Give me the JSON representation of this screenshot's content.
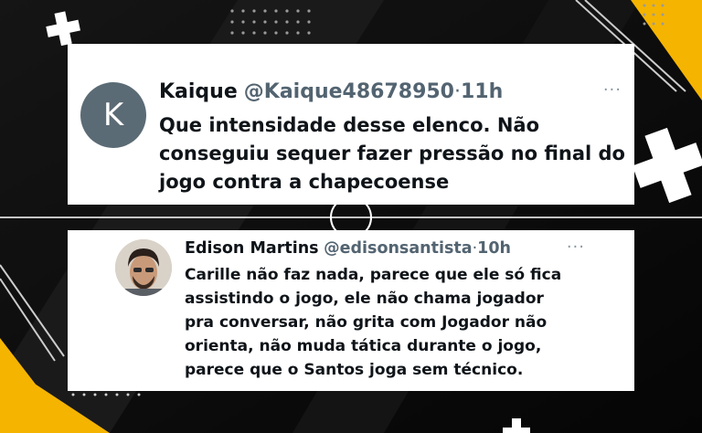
{
  "tweets": [
    {
      "avatar_letter": "K",
      "name": "Kaique",
      "handle": "@Kaique48678950",
      "separator": "·",
      "time": "11h",
      "more": "···",
      "lines": [
        "Que intensidade desse elenco. Não",
        "conseguiu sequer fazer pressão no final do",
        "jogo contra a chapecoense"
      ]
    },
    {
      "name": "Edison Martins",
      "handle": "@edisonsantista",
      "separator": "·",
      "time": "10h",
      "more": "···",
      "lines": [
        "Carille não faz nada, parece que ele só fica",
        "assistindo o jogo, ele não chama jogador",
        "pra conversar, não grita com Jogador não",
        "orienta, não muda tática durante o jogo,",
        "parece que o Santos joga sem técnico."
      ]
    }
  ],
  "colors": {
    "background": "#0b0b0b",
    "accent_yellow": "#f5b400",
    "card": "#ffffff",
    "text": "#0f1419",
    "muted": "#536471",
    "avatar": "#5b6b75"
  }
}
